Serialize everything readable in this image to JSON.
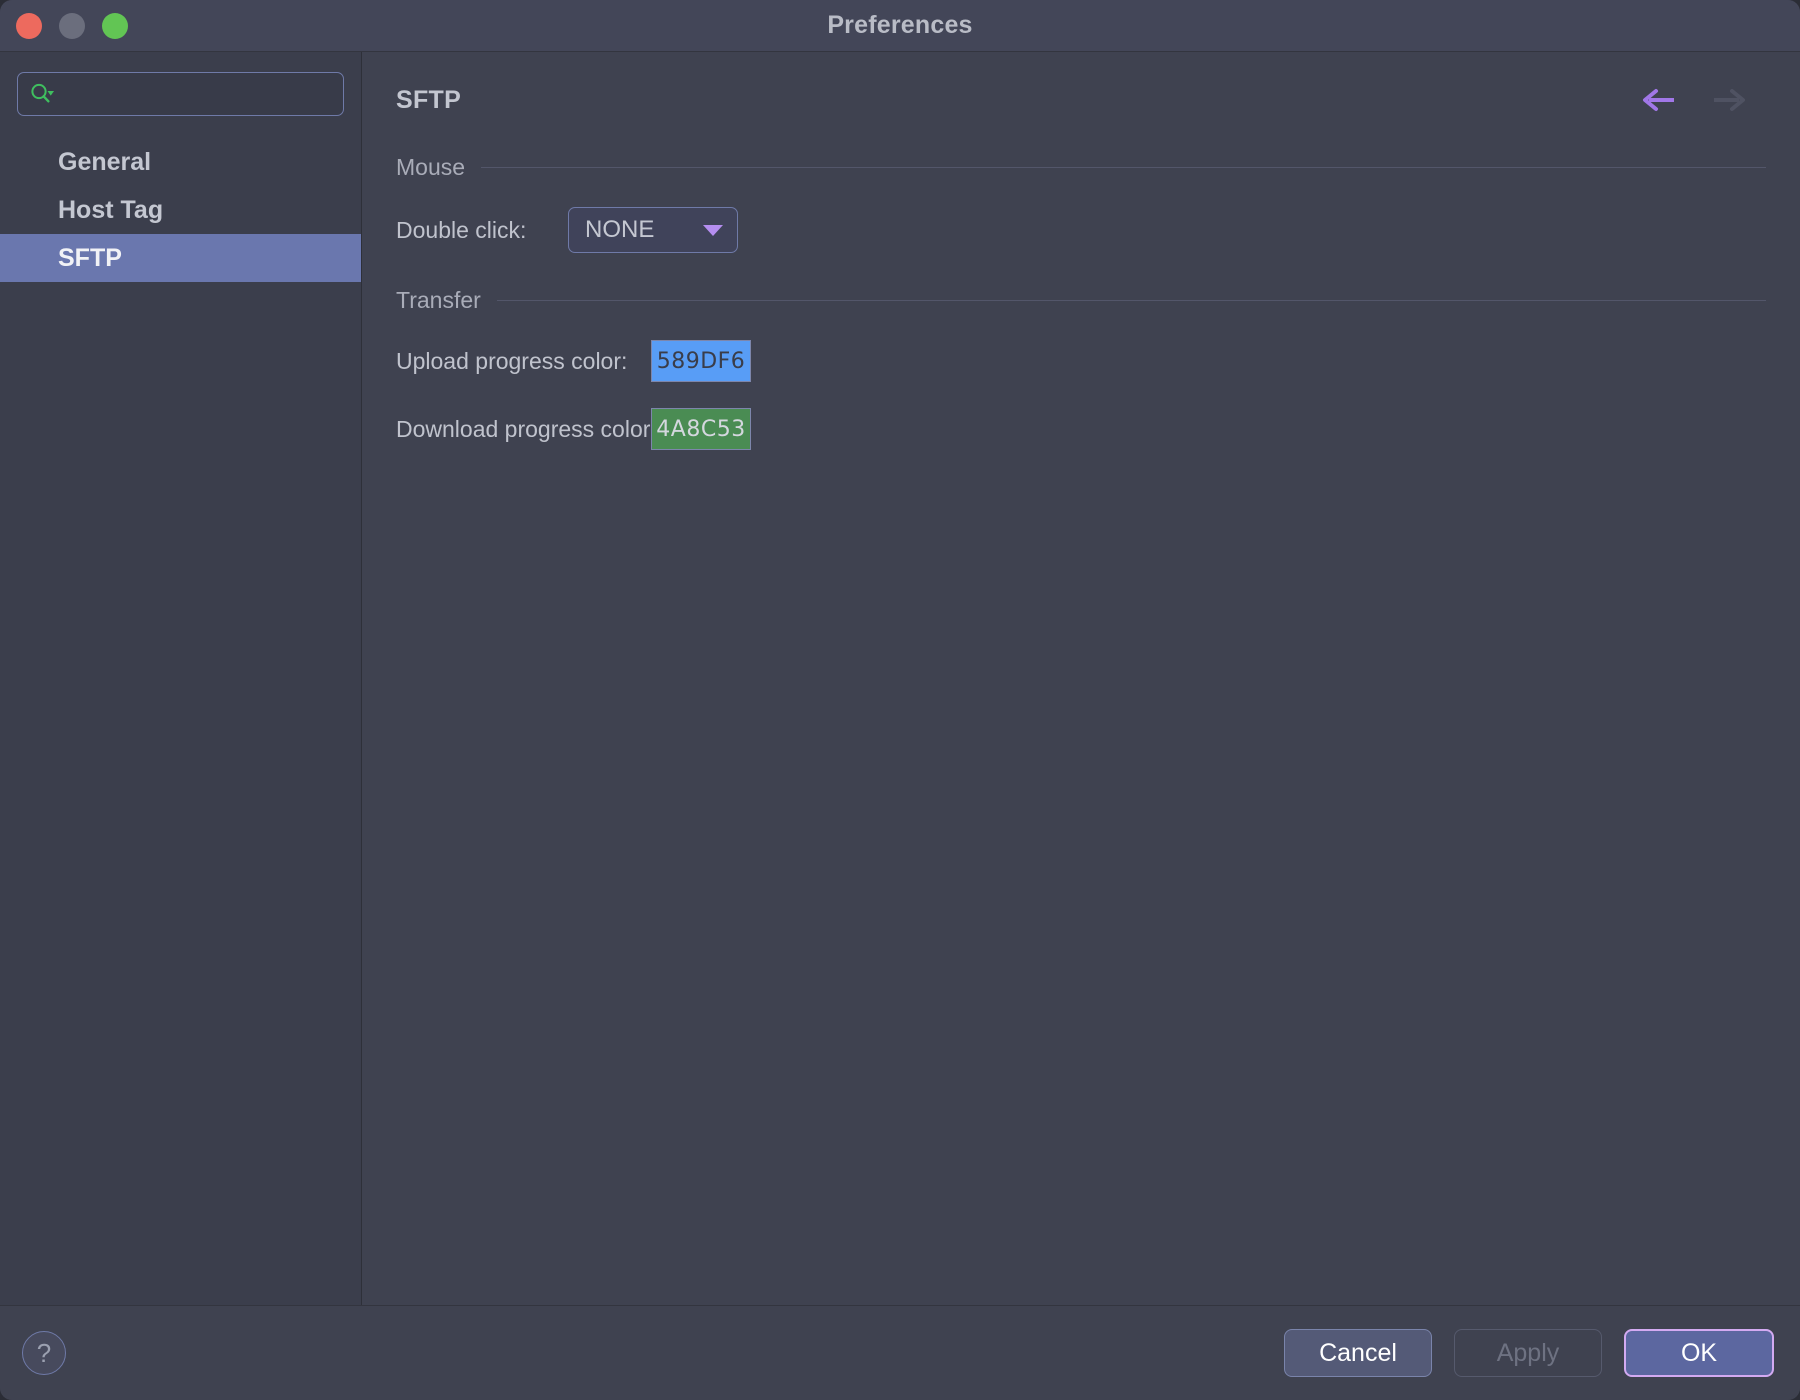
{
  "window": {
    "title": "Preferences",
    "traffic_lights": [
      {
        "name": "close",
        "color": "#ed6a5e"
      },
      {
        "name": "minimize",
        "color": "#6b6e7d"
      },
      {
        "name": "zoom",
        "color": "#62c554"
      }
    ]
  },
  "sidebar": {
    "search": {
      "value": "",
      "placeholder": "",
      "icon": "search-icon"
    },
    "items": [
      {
        "label": "General",
        "selected": false
      },
      {
        "label": "Host Tag",
        "selected": false
      },
      {
        "label": "SFTP",
        "selected": true
      }
    ],
    "selection_color": "#6a77ae"
  },
  "content": {
    "page_title": "SFTP",
    "nav": {
      "back": {
        "icon": "arrow-left-icon",
        "enabled": true,
        "color": "#a177e8"
      },
      "forward": {
        "icon": "arrow-right-icon",
        "enabled": false,
        "color": "#4a4d5c"
      }
    },
    "sections": [
      {
        "title": "Mouse",
        "fields": [
          {
            "label": "Double click:",
            "type": "combobox",
            "value": "NONE",
            "options": [
              "NONE"
            ]
          }
        ]
      },
      {
        "title": "Transfer",
        "fields": [
          {
            "label": "Upload progress color:",
            "type": "color",
            "value": "589DF6",
            "swatch_bg": "#589df6",
            "swatch_fg": "#3a3d49"
          },
          {
            "label": "Download progress color:",
            "type": "color",
            "value": "4A8C53",
            "swatch_bg": "#4a8c53",
            "swatch_fg": "#d4d7de"
          }
        ]
      }
    ]
  },
  "footer": {
    "help_label": "?",
    "buttons": [
      {
        "label": "Cancel",
        "state": "normal"
      },
      {
        "label": "Apply",
        "state": "disabled"
      },
      {
        "label": "OK",
        "state": "default"
      }
    ]
  }
}
